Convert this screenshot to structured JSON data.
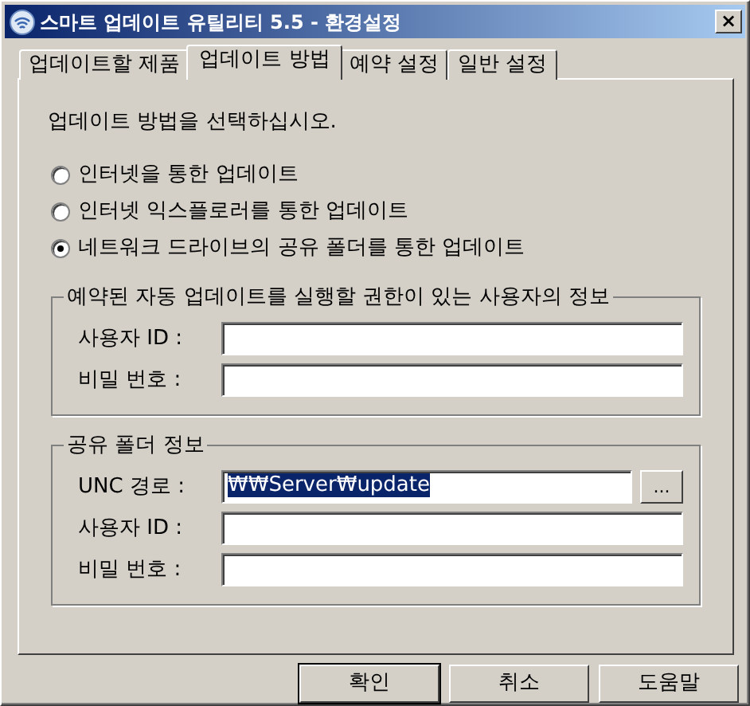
{
  "window": {
    "title": "스마트 업데이트 유틸리티 5.5 - 환경설정",
    "close": "×"
  },
  "tabs": [
    {
      "label": "업데이트할 제품",
      "selected": false
    },
    {
      "label": "업데이트 방법",
      "selected": true
    },
    {
      "label": "예약 설정",
      "selected": false
    },
    {
      "label": "일반 설정",
      "selected": false
    }
  ],
  "prompt": "업데이트 방법을 선택하십시오.",
  "methods": [
    {
      "label": "인터넷을 통한 업데이트",
      "selected": false
    },
    {
      "label": "인터넷 익스플로러를 통한 업데이트",
      "selected": false
    },
    {
      "label": "네트워크 드라이브의 공유 폴더를 통한 업데이트",
      "selected": true
    }
  ],
  "groups": [
    {
      "title": "예약된 자동 업데이트를 실행할 권한이 있는 사용자의 정보",
      "fields": [
        {
          "label": "사용자 ID :"
        },
        {
          "label": "비밀 번호 :"
        }
      ]
    },
    {
      "title": "공유 폴더 정보",
      "fields": [
        {
          "label": "UNC 경로 :",
          "value": "₩₩Server₩update",
          "text_selected": true,
          "browse": "..."
        },
        {
          "label": "사용자 ID :"
        },
        {
          "label": "비밀 번호 :"
        }
      ]
    }
  ],
  "buttons": [
    {
      "label": "확인",
      "default": true
    },
    {
      "label": "취소",
      "default": false
    },
    {
      "label": "도움말",
      "default": false
    }
  ]
}
